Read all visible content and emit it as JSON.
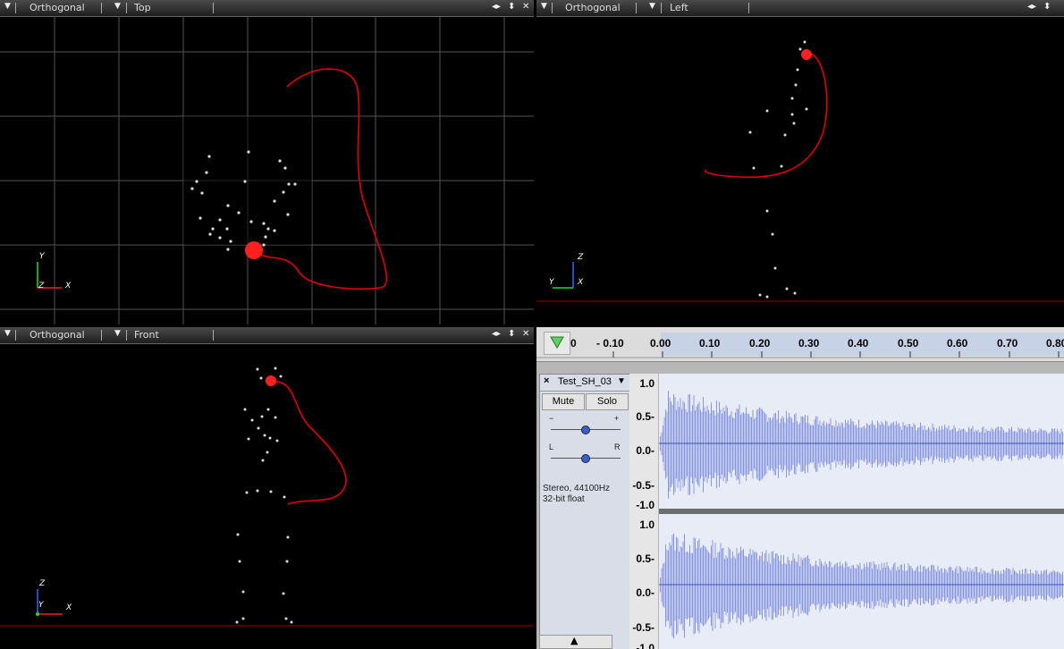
{
  "viewports": [
    {
      "id": "top",
      "mode": "Orthogonal",
      "view": "Top",
      "axes": [
        "Y",
        "Z",
        "X"
      ]
    },
    {
      "id": "left",
      "mode": "Orthogonal",
      "view": "Left",
      "axes": [
        "Z",
        "Y",
        "X"
      ]
    },
    {
      "id": "front",
      "mode": "Orthogonal",
      "view": "Front",
      "axes": [
        "Z",
        "Y",
        "X"
      ]
    }
  ],
  "audio": {
    "ruler_labels": [
      "0",
      "- 0.10",
      "0.00",
      "0.10",
      "0.20",
      "0.30",
      "0.40",
      "0.50",
      "0.60",
      "0.70",
      "0.80"
    ],
    "track": {
      "name": "Test_SH_03",
      "close": "×",
      "mute": "Mute",
      "solo": "Solo",
      "gain_minus": "−",
      "gain_plus": "+",
      "pan_left": "L",
      "pan_right": "R",
      "info_line1": "Stereo, 44100Hz",
      "info_line2": "32-bit float"
    },
    "vruler_top": [
      "1.0",
      "0.5-",
      "0.0-",
      "-0.5-",
      "-1.0"
    ],
    "vruler_bottom": [
      "1.0",
      "0.5-",
      "0.0-",
      "-0.5-",
      "-1.0"
    ]
  },
  "colors": {
    "trajectory": "#e00000",
    "marker": "#ff2020",
    "waveform": "#4a5fd0",
    "grid": "#555555"
  }
}
